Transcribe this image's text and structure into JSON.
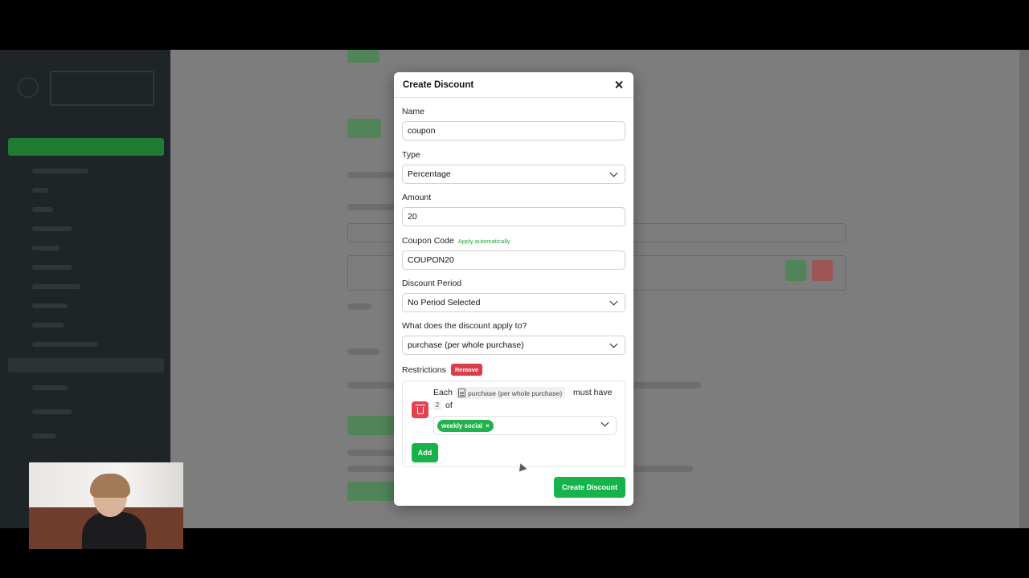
{
  "modal": {
    "title": "Create Discount",
    "name": {
      "label": "Name",
      "value": "coupon"
    },
    "type": {
      "label": "Type",
      "value": "Percentage"
    },
    "amount": {
      "label": "Amount",
      "value": "20"
    },
    "coupon_code": {
      "label": "Coupon Code",
      "apply_auto": "Apply automatically",
      "value": "COUPON20"
    },
    "discount_period": {
      "label": "Discount Period",
      "value": "No Period Selected"
    },
    "applies_to": {
      "label": "What does the discount apply to?",
      "value": "purchase (per whole purchase)"
    },
    "restrictions": {
      "label": "Restrictions",
      "remove_label": "Remove",
      "each": "Each",
      "chip": "purchase (per whole purchase)",
      "must_have": "must have",
      "count": "2",
      "of": "of",
      "tag": "weekly social",
      "tag_remove": "×",
      "add_label": "Add"
    },
    "create_label": "Create Discount"
  },
  "colors": {
    "accent_green": "#16b34a",
    "danger_red": "#dc3d4b"
  },
  "icons": [
    "close-icon",
    "chevron-down-icon",
    "trash-icon",
    "document-icon"
  ]
}
